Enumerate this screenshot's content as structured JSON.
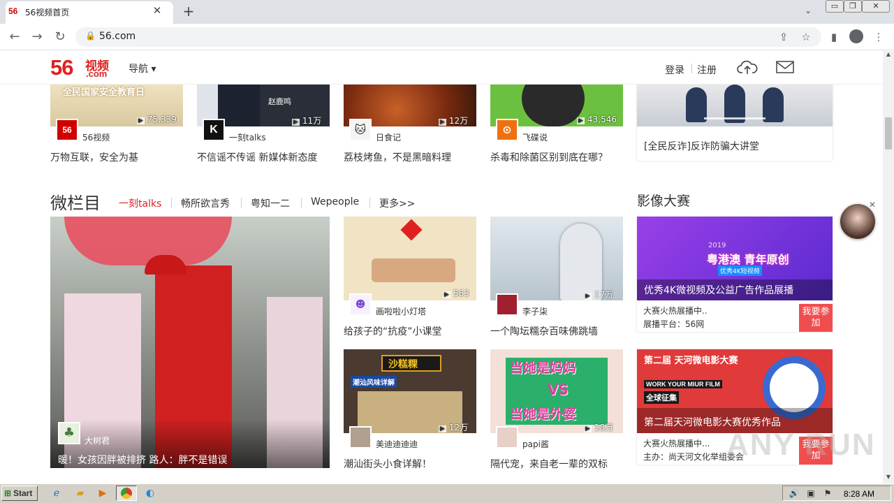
{
  "browser": {
    "tab_title": "56视频首页",
    "tab_logo": "56",
    "url": "56.com",
    "window_buttons": [
      "▭",
      "❐",
      "✕"
    ]
  },
  "header": {
    "logo_number": "56",
    "logo_word": "视频",
    "logo_domain": ".com",
    "nav_label": "导航 ▾",
    "login": "登录",
    "register": "注册"
  },
  "top_row": [
    {
      "thumb_text": "全民国家安全教育日",
      "count": "75,339",
      "author": "56视频",
      "title": "万物互联，安全为基",
      "avatar_text": "56",
      "color": "#e8d8b8"
    },
    {
      "thumb_text": "赵鹿鸣",
      "count": "11万",
      "author": "一刻talks",
      "title": "不信谣不传谣 新媒体新态度",
      "avatar_text": "K",
      "color": "#2a2e38"
    },
    {
      "thumb_text": "",
      "count": "12万",
      "author": "日食记",
      "title": "荔枝烤鱼，不是黑暗料理",
      "avatar_text": "",
      "color": "#8a3a18"
    },
    {
      "thumb_text": "",
      "count": "43,546",
      "author": "飞碟说",
      "title": "杀毒和除菌区别到底在哪？",
      "avatar_text": "",
      "color": "#6cc040"
    }
  ],
  "top_feature": {
    "title": "[全民反诈]反诈防骗大讲堂"
  },
  "micro_section": {
    "title": "微栏目",
    "tabs": [
      "一刻talks",
      "畅所欲言秀",
      "粤知一二",
      "Wepeople",
      "更多>>"
    ],
    "big_video": {
      "author": "大树君",
      "title": "暖！女孩因胖被排挤 路人：胖不是错误"
    },
    "videos": [
      {
        "count": "563",
        "author": "画啦啦小灯塔",
        "title": "给孩子的“抗疫”小课堂",
        "color": "#f0e4c4"
      },
      {
        "count": "17万",
        "author": "李子柒",
        "title": "一个陶坛糯杂百味佛跳墙",
        "color": "#c8d4dc"
      },
      {
        "count": "12万",
        "author": "美迪迪迪迪",
        "title": "潮汕街头小食详解！",
        "thumb_text": "沙糕粿",
        "thumb_text2": "潮汕风味详解",
        "color": "#4a3a30"
      },
      {
        "count": "18万",
        "author": "papi酱",
        "title": "隔代宠，来自老一辈的双标",
        "thumb_text": "当她是妈妈",
        "thumb_text2": "VS",
        "thumb_text3": "当她是外婆",
        "color": "#2ab06a"
      }
    ]
  },
  "contest": {
    "title": "影像大赛",
    "items": [
      {
        "banner_text": "粤港澳 青年原创",
        "banner_sub": "优秀4K短视频",
        "year": "2019",
        "caption": "优秀4K微视频及公益广告作品展播",
        "line1": "大赛火热展播中..",
        "line2": "展播平台：56网",
        "join": "我要参加",
        "color": "#7a3ae0"
      },
      {
        "banner_text": "第二届 天河微电影大赛",
        "banner_sub": "WORK YOUR MIUR FILM",
        "tag": "全球征集",
        "caption": "第二届天河微电影大赛优秀作品",
        "line1": "大赛火热展播中...",
        "line2": "主办：尚天河文化举组委会",
        "join": "我要参加",
        "color": "#e03a3a"
      }
    ]
  },
  "taskbar": {
    "start": "Start",
    "clock": "8:28 AM"
  },
  "watermark": "ANY RUN"
}
